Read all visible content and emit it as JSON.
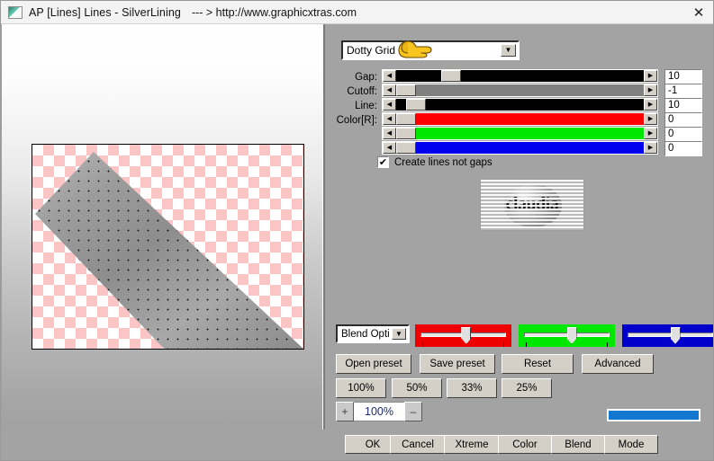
{
  "window": {
    "icon": "app-image-icon",
    "title": "AP [Lines]  Lines - SilverLining",
    "url": "--- > http://www.graphicxtras.com",
    "close_glyph": "✕"
  },
  "preview": {
    "zoom_label": "100%",
    "checker_color": "#fcc5c5",
    "shape_fill": "#8f8f8f"
  },
  "preset": {
    "selected": "Dotty Grid",
    "arrow_glyph": "▼"
  },
  "sliders": [
    {
      "label": "Gap:",
      "value": "10",
      "track_color": "#000000",
      "thumb_pct": 18,
      "fill_before_pct": 0
    },
    {
      "label": "Cutoff:",
      "value": "-1",
      "track_color": "#808080",
      "thumb_pct": 0,
      "fill_before_pct": 0
    },
    {
      "label": "Line:",
      "value": "10",
      "track_color": "#000000",
      "thumb_pct": 4,
      "fill_before_pct": 0
    },
    {
      "label": "Color[R]:",
      "value": "0",
      "track_color": "#ff0000",
      "thumb_pct": 0,
      "fill_before_pct": 0
    },
    {
      "label": "",
      "value": "0",
      "track_color": "#00e800",
      "thumb_pct": 0,
      "fill_before_pct": 0
    },
    {
      "label": "",
      "value": "0",
      "track_color": "#0000ee",
      "thumb_pct": 0,
      "fill_before_pct": 0
    }
  ],
  "checkbox": {
    "label": "Create lines not gaps",
    "checked": true,
    "check_glyph": "✔"
  },
  "watermark": {
    "text": "claudia"
  },
  "blend_combo": {
    "selected": "Blend Opti",
    "arrow_glyph": "▼"
  },
  "trackbars": [
    {
      "name": "red",
      "color": "#ee0000",
      "thumb_pct": 50
    },
    {
      "name": "green",
      "color": "#00e800",
      "thumb_pct": 52
    },
    {
      "name": "blue",
      "color": "#0000cc",
      "thumb_pct": 52
    }
  ],
  "preset_buttons": [
    {
      "label": "Open preset"
    },
    {
      "label": "Save preset"
    },
    {
      "label": "Reset"
    },
    {
      "label": "Advanced"
    }
  ],
  "scale_buttons": [
    {
      "label": "100%"
    },
    {
      "label": "50%"
    },
    {
      "label": "33%"
    },
    {
      "label": "25%"
    }
  ],
  "zoom_stepper": {
    "plus": "+",
    "minus": "–",
    "value": "100%"
  },
  "progress": {
    "percent": 100,
    "color": "#1277cf"
  },
  "bottom_buttons": [
    {
      "label": "OK"
    },
    {
      "label": "Cancel"
    },
    {
      "label": "Xtreme"
    },
    {
      "label": "Color"
    },
    {
      "label": "Blend"
    },
    {
      "label": "Mode"
    }
  ]
}
